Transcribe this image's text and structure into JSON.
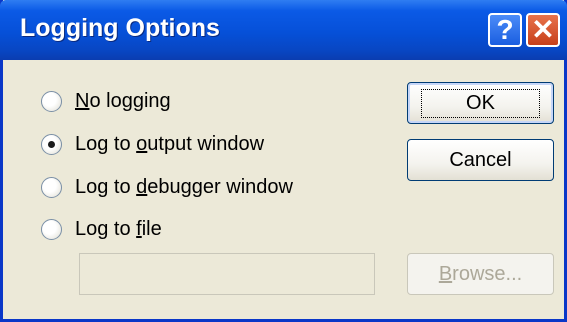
{
  "window": {
    "title": "Logging Options",
    "help_icon": "question-mark-icon",
    "close_icon": "close-x-icon"
  },
  "options": [
    {
      "pre": "",
      "ul": "N",
      "post": "o logging",
      "checked": false
    },
    {
      "pre": "Log to ",
      "ul": "o",
      "post": "utput window",
      "checked": true
    },
    {
      "pre": "Log to ",
      "ul": "d",
      "post": "ebugger window",
      "checked": false
    },
    {
      "pre": "Log to ",
      "ul": "f",
      "post": "ile",
      "checked": false
    }
  ],
  "buttons": {
    "ok": "OK",
    "cancel": "Cancel",
    "browse_ul": "B",
    "browse_rest": "rowse..."
  },
  "file_path": {
    "value": "",
    "enabled": false
  },
  "colors": {
    "titlebar": "#0650d8",
    "frame": "#0a37c8",
    "client_bg": "#ece9d8",
    "close_button": "#c7401a"
  }
}
